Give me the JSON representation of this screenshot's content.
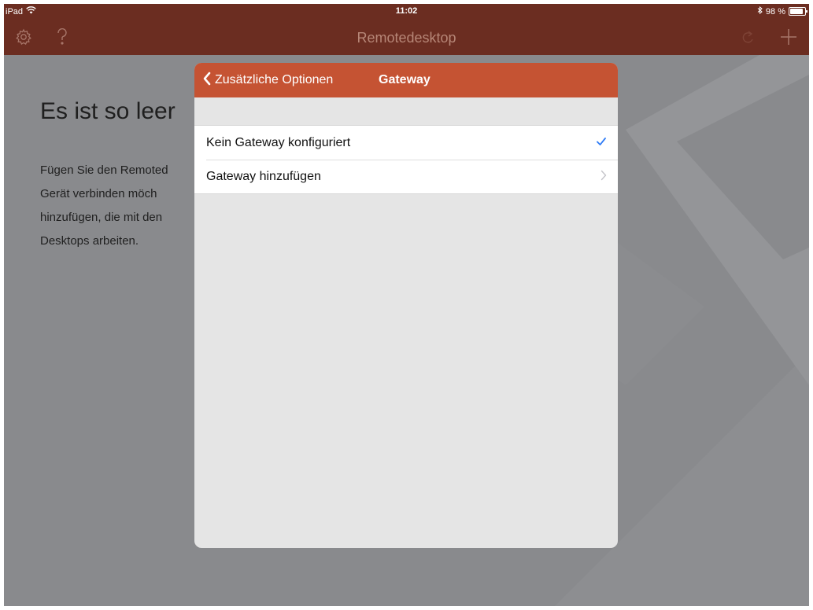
{
  "status_bar": {
    "device": "iPad",
    "time": "11:02",
    "battery": "98 %",
    "battery_level": 0.98,
    "icons": [
      "wifi-icon",
      "bluetooth-icon",
      "battery-icon"
    ]
  },
  "nav": {
    "title": "Remotedesktop",
    "icons": [
      "gear-icon",
      "help-icon",
      "refresh-icon",
      "add-icon"
    ]
  },
  "empty_state": {
    "title": "Es ist so leer",
    "lines": [
      "Fügen Sie den Remoted",
      "Gerät  verbinden  möch",
      "hinzufügen, die mit den",
      "Desktops arbeiten."
    ]
  },
  "modal": {
    "back_label": "Zusätzliche Optionen",
    "title": "Gateway",
    "rows": [
      {
        "label": "Kein Gateway konfiguriert",
        "accessory": "checkmark-icon",
        "selected": true
      },
      {
        "label": "Gateway hinzufügen",
        "accessory": "chevron-right-icon",
        "selected": false
      }
    ]
  },
  "colors": {
    "nav_background": "#6b2d21",
    "modal_header": "#c55333",
    "overlay": "#898a8d",
    "checkmark": "#2f7cf6"
  }
}
